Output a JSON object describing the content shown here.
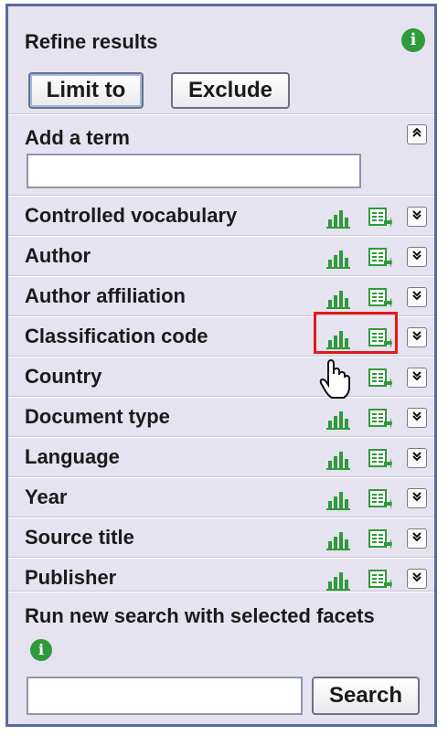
{
  "panel": {
    "title": "Refine results",
    "info_icon_glyph": "i",
    "limit_label": "Limit to",
    "exclude_label": "Exclude"
  },
  "add_term": {
    "label": "Add a term",
    "value": "",
    "collapse_glyph": "⌃"
  },
  "facets": [
    {
      "label": "Controlled vocabulary"
    },
    {
      "label": "Author"
    },
    {
      "label": "Author affiliation"
    },
    {
      "label": "Classification code"
    },
    {
      "label": "Country"
    },
    {
      "label": "Document type"
    },
    {
      "label": "Language"
    },
    {
      "label": "Year"
    },
    {
      "label": "Source title"
    },
    {
      "label": "Publisher"
    }
  ],
  "run_search": {
    "text": "Run new search with selected facets",
    "info_icon_glyph": "i",
    "input_value": "",
    "button_label": "Search"
  },
  "colors": {
    "accent_green": "#2f9a3a",
    "highlight_red": "#e11a1a",
    "panel_bg": "#e6e3f0",
    "panel_border": "#5a6aa0"
  },
  "icons": {
    "chart": "bar-chart-icon",
    "export": "export-list-icon",
    "expand": "double-chevron-down-icon",
    "collapse": "double-chevron-up-icon",
    "info": "info-icon",
    "cursor": "hand-cursor-icon"
  }
}
